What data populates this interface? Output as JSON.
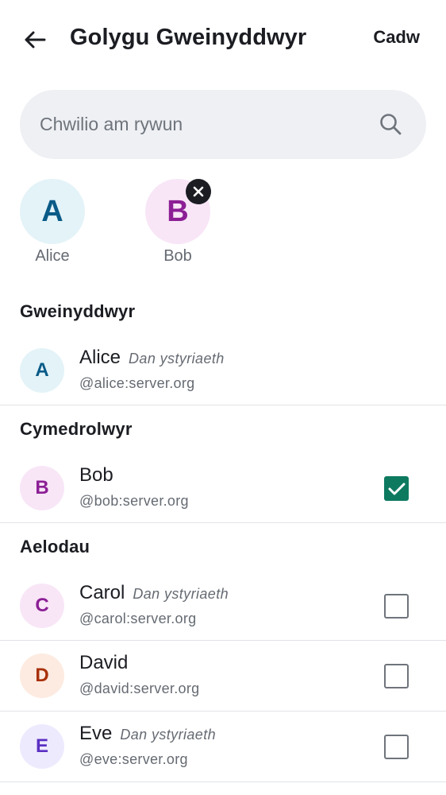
{
  "header": {
    "title": "Golygu Gweinyddwyr",
    "save_label": "Cadw"
  },
  "search": {
    "placeholder": "Chwilio am rywun"
  },
  "selected": [
    {
      "initial": "A",
      "name": "Alice",
      "bg": "#e3f3f8",
      "fg": "#0a5b87",
      "removable": false
    },
    {
      "initial": "B",
      "name": "Bob",
      "bg": "#f8e6f7",
      "fg": "#8c1f95",
      "removable": true
    }
  ],
  "sections": {
    "admins": "Gweinyddwyr",
    "moderators": "Cymedrolwyr",
    "members": "Aelodau"
  },
  "pending_label": "Dan ystyriaeth",
  "rows": [
    {
      "initial": "A",
      "name": "Alice",
      "handle": "@alice:server.org",
      "pending": "Dan ystyriaeth",
      "checked": null,
      "bg": "#e3f3f8",
      "fg": "#0a5b87"
    },
    {
      "initial": "B",
      "name": "Bob",
      "handle": "@bob:server.org",
      "pending": "",
      "checked": true,
      "bg": "#f8e6f7",
      "fg": "#8c1f95"
    },
    {
      "initial": "C",
      "name": "Carol",
      "handle": "@carol:server.org",
      "pending": "Dan ystyriaeth",
      "checked": false,
      "bg": "#f8e6f7",
      "fg": "#8c1f95"
    },
    {
      "initial": "D",
      "name": "David",
      "handle": "@david:server.org",
      "pending": "",
      "checked": false,
      "bg": "#fdebe1",
      "fg": "#a8310a"
    },
    {
      "initial": "E",
      "name": "Eve",
      "handle": "@eve:server.org",
      "pending": "Dan ystyriaeth",
      "checked": false,
      "bg": "#eeeafe",
      "fg": "#5a2fc2"
    }
  ],
  "colors": {
    "accent_checkbox": "#0d7a60",
    "search_bg": "#eef0f4",
    "text_primary": "#1b1d22",
    "text_secondary": "#656a72"
  },
  "icons": {
    "back": "arrow-left-icon",
    "search": "search-icon",
    "remove": "close-icon",
    "check": "checkmark-icon"
  }
}
